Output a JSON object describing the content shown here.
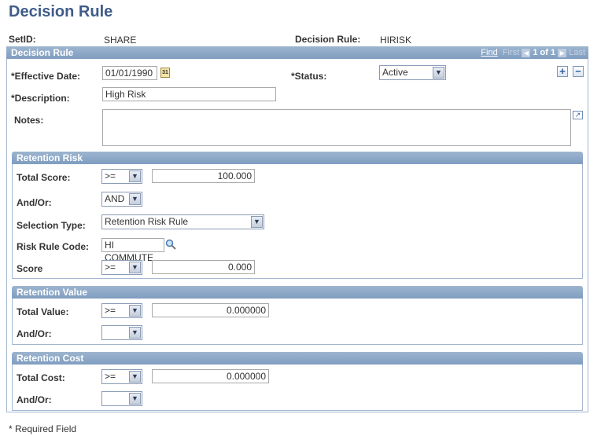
{
  "page": {
    "title": "Decision Rule"
  },
  "keys": {
    "setid_label": "SetID:",
    "setid_value": "SHARE",
    "rule_label": "Decision Rule:",
    "rule_value": "HIRISK"
  },
  "main_section": {
    "header": "Decision Rule",
    "nav": {
      "find": "Find",
      "first": "First",
      "count": "1 of 1",
      "last": "Last"
    },
    "effective_date_label": "*Effective Date:",
    "effective_date_value": "01/01/1990",
    "calendar_icon": "31",
    "status_label": "*Status:",
    "status_value": "Active",
    "description_label": "*Description:",
    "description_value": "High Risk",
    "notes_label": "Notes:",
    "notes_value": "",
    "add_label": "+",
    "remove_label": "−"
  },
  "retention_risk": {
    "header": "Retention Risk",
    "total_score_label": "Total Score:",
    "total_score_operator": ">=",
    "total_score_value": "100.000",
    "and_or_label": "And/Or:",
    "and_or_value": "AND",
    "selection_type_label": "Selection Type:",
    "selection_type_value": "Retention Risk Rule",
    "risk_rule_code_label": "Risk Rule Code:",
    "risk_rule_code_value": "HI COMMUTE",
    "score_label": "Score",
    "score_operator": ">=",
    "score_value": "0.000"
  },
  "retention_value": {
    "header": "Retention Value",
    "total_value_label": "Total Value:",
    "total_value_operator": ">=",
    "total_value_value": "0.000000",
    "and_or_label": "And/Or:",
    "and_or_value": ""
  },
  "retention_cost": {
    "header": "Retention Cost",
    "total_cost_label": "Total Cost:",
    "total_cost_operator": ">=",
    "total_cost_value": "0.000000",
    "and_or_label": "And/Or:",
    "and_or_value": ""
  },
  "footer": {
    "required_note": "* Required Field"
  },
  "arrow_glyph": "▼"
}
